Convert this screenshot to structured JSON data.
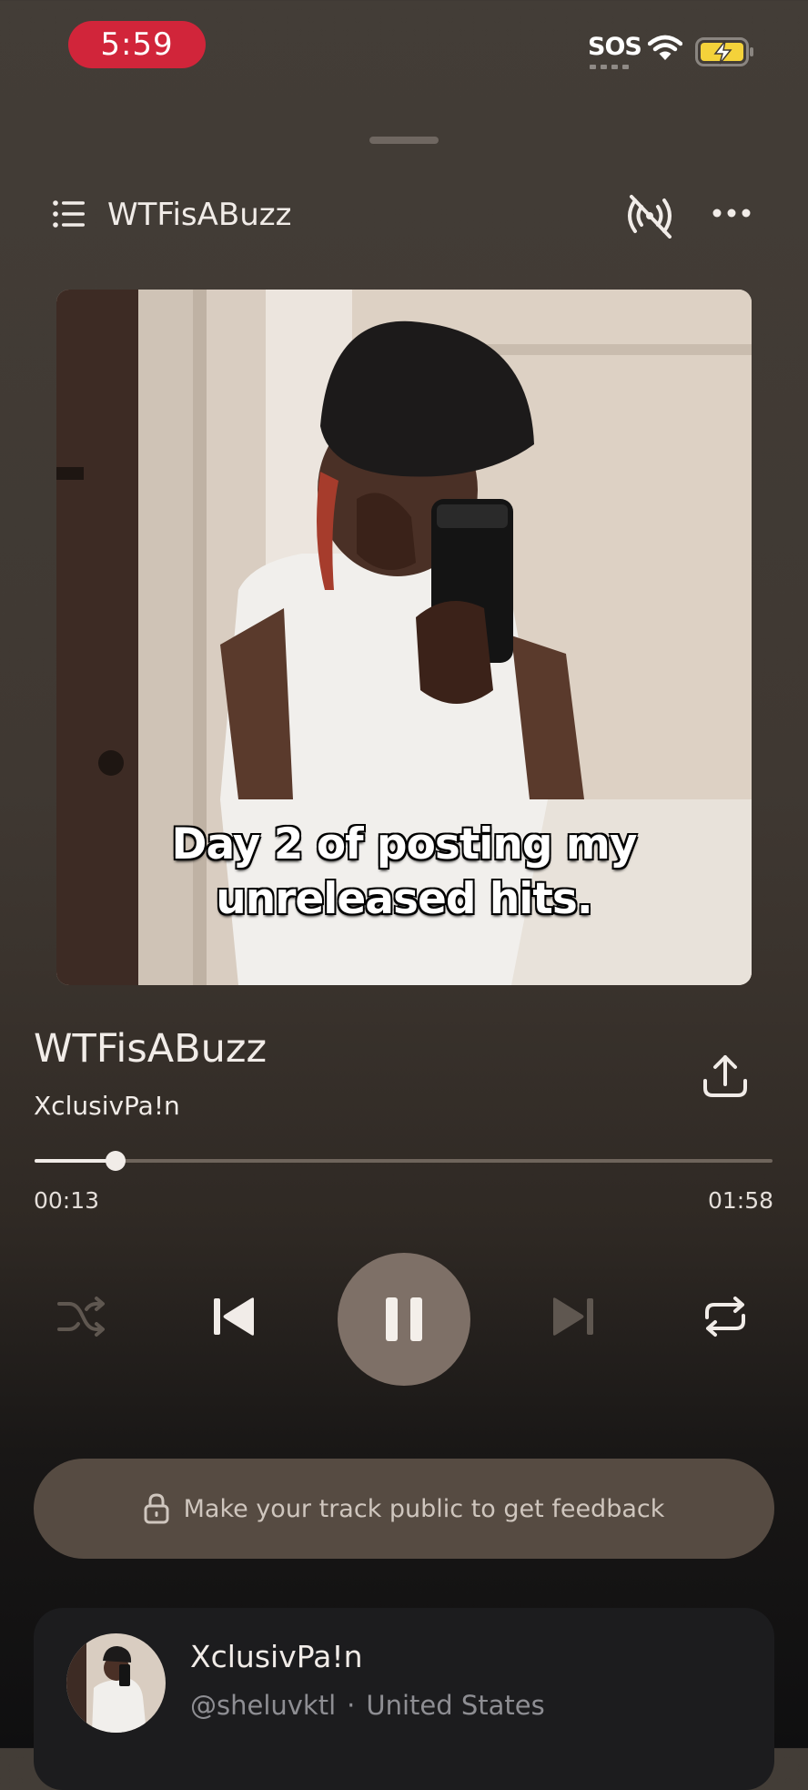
{
  "status_bar": {
    "time": "5:59",
    "sos": "SOS"
  },
  "header": {
    "title": "WTFisABuzz"
  },
  "artwork": {
    "caption_line1": "Day 2 of posting my",
    "caption_line2": "unreleased hits."
  },
  "track": {
    "title": "WTFisABuzz",
    "artist": "XclusivPa!n"
  },
  "progress": {
    "elapsed": "00:13",
    "total": "01:58",
    "fraction": 0.11
  },
  "feedback": {
    "text": "Make your track public to get feedback"
  },
  "artist_card": {
    "name": "XclusivPa!n",
    "handle": "@sheluvktl",
    "separator": "·",
    "location": "United States"
  },
  "icons": [
    "queue-icon",
    "cast-off-icon",
    "more-icon",
    "share-icon",
    "shuffle-icon",
    "previous-icon",
    "pause-icon",
    "next-icon",
    "repeat-icon",
    "lock-icon",
    "wifi-icon",
    "battery-charging-icon"
  ],
  "colors": {
    "status_pill": "#d1253a",
    "battery": "#f4d23a",
    "play_button": "#7e7067",
    "feedback_pill": "#564b42"
  }
}
